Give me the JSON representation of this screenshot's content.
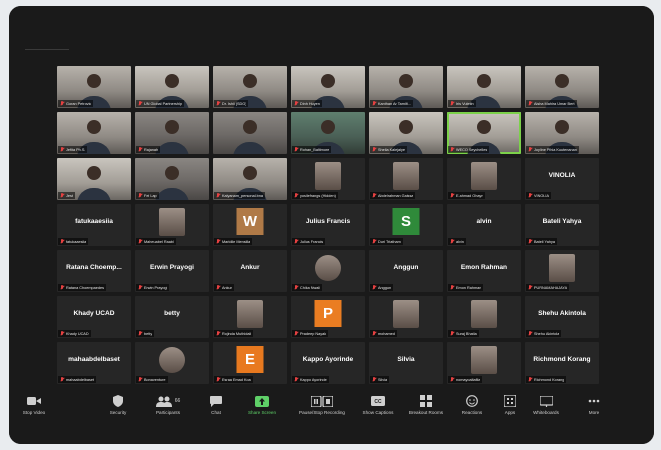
{
  "colors": {
    "mic_muted": "#e54141",
    "active_speaker": "#7cd14a",
    "share_screen": "#5fd068",
    "tile_w": "#b07a47",
    "tile_s": "#2f8a3a",
    "tile_p": "#ea7d22",
    "tile_e": "#e8791f"
  },
  "participants": [
    {
      "label": "Goran Petrovic",
      "type": "video",
      "v": "v2"
    },
    {
      "label": "UN Global Partnership",
      "type": "video",
      "v": "v3"
    },
    {
      "label": "Dr. Ishii (SDG)",
      "type": "video",
      "v": "v2"
    },
    {
      "label": "Dinh Huyen",
      "type": "video",
      "v": "v3"
    },
    {
      "label": "Kanthan Ar Tamilt...",
      "type": "video",
      "v": "v2"
    },
    {
      "label": "Iris Vuletin",
      "type": "video",
      "v": "v3"
    },
    {
      "label": "Aisha Mahira Umar Bert",
      "type": "video",
      "v": "v2"
    },
    {
      "label": "Jefita Ph.S.",
      "type": "video",
      "v": "v2"
    },
    {
      "label": "Rajanah",
      "type": "video",
      "v": "v1"
    },
    {
      "label": "",
      "type": "video",
      "v": "v1"
    },
    {
      "label": "Rohan_Baltimore",
      "type": "video",
      "v": "v4"
    },
    {
      "label": "Sheila Kalejaiye",
      "type": "video",
      "v": "v3"
    },
    {
      "label": "WECO Seychelles",
      "type": "video",
      "v": "v3",
      "active": true
    },
    {
      "label": "Joyline Pihia Kuutenanan",
      "type": "video",
      "v": "v2"
    },
    {
      "label": "Jest",
      "type": "video",
      "v": "v3"
    },
    {
      "label": "Fei Lap",
      "type": "video",
      "v": "v1"
    },
    {
      "label": "Kalyanam_personal.bna",
      "type": "video",
      "v": "v2"
    },
    {
      "label": "yosilefrangs (Hidden)",
      "type": "pic"
    },
    {
      "label": "Abdelrahman Gaissa",
      "type": "pic"
    },
    {
      "label": "E.ahmad Ohayn",
      "type": "pic"
    },
    {
      "label": "VINOLIA",
      "type": "name",
      "name": "VINOLIA"
    },
    {
      "label": "fatukaaesiia",
      "type": "name",
      "name": "fatukaaesiia"
    },
    {
      "label": "Maheuabel Raabl",
      "type": "pic"
    },
    {
      "label": "Maridile Mensiila",
      "type": "letter",
      "letter": "W",
      "ckey": "tile_w"
    },
    {
      "label": "Julius Francis",
      "type": "name",
      "name": "Julius Francis"
    },
    {
      "label": "Duri Triatham",
      "type": "letter",
      "letter": "S",
      "ckey": "tile_s"
    },
    {
      "label": "alvin",
      "type": "name",
      "name": "alvin"
    },
    {
      "label": "Bateli Yahya",
      "type": "name",
      "name": "Bateli Yahya"
    },
    {
      "label": "Ratana Choempaedes",
      "type": "name",
      "name": "Ratana Choemp..."
    },
    {
      "label": "Erwin Prayogi",
      "type": "name",
      "name": "Erwin Prayogi"
    },
    {
      "label": "Ankur",
      "type": "name",
      "name": "Ankur"
    },
    {
      "label": "Chika Nwali",
      "type": "pic",
      "round": true
    },
    {
      "label": "Anggun",
      "type": "name",
      "name": "Anggun"
    },
    {
      "label": "Emon Rahman",
      "type": "name",
      "name": "Emon Rahman"
    },
    {
      "label": "PURNAMAHAJAYA",
      "type": "pic"
    },
    {
      "label": "Khady UCAD",
      "type": "name",
      "name": "Khady UCAD"
    },
    {
      "label": "betty",
      "type": "name",
      "name": "betty"
    },
    {
      "label": "Rojinda Muthidali",
      "type": "pic"
    },
    {
      "label": "Pradeep Nayak",
      "type": "letter",
      "letter": "P",
      "ckey": "tile_p"
    },
    {
      "label": "mohamed",
      "type": "pic"
    },
    {
      "label": "Suraj Bhatia",
      "type": "pic"
    },
    {
      "label": "Shehu Akintola",
      "type": "name",
      "name": "Shehu Akintola"
    },
    {
      "label": "mahaabdelbaset",
      "type": "name",
      "name": "mahaabdelbaset"
    },
    {
      "label": "Bonaventure",
      "type": "pic",
      "round": true
    },
    {
      "label": "Esraa Emad Koa",
      "type": "letter",
      "letter": "E",
      "ckey": "tile_e"
    },
    {
      "label": "Kappo Ayorinde",
      "type": "name",
      "name": "Kappo Ayorinde"
    },
    {
      "label": "Silvia",
      "type": "name",
      "name": "Silvia"
    },
    {
      "label": "nomayoaltafila",
      "type": "pic"
    },
    {
      "label": "Richmond Korang",
      "type": "name",
      "name": "Richmond Korang"
    }
  ],
  "toolbar": {
    "stop_video": "Stop Video",
    "security": "Security",
    "participants": "Participants",
    "participants_count": "66",
    "chat": "Chat",
    "share_screen": "Share Screen",
    "pause_recording": "Pause/Stop Recording",
    "show_captions": "Show Captions",
    "breakout_rooms": "Breakout Rooms",
    "reactions": "Reactions",
    "apps": "Apps",
    "whiteboards": "Whiteboards",
    "more": "More"
  }
}
